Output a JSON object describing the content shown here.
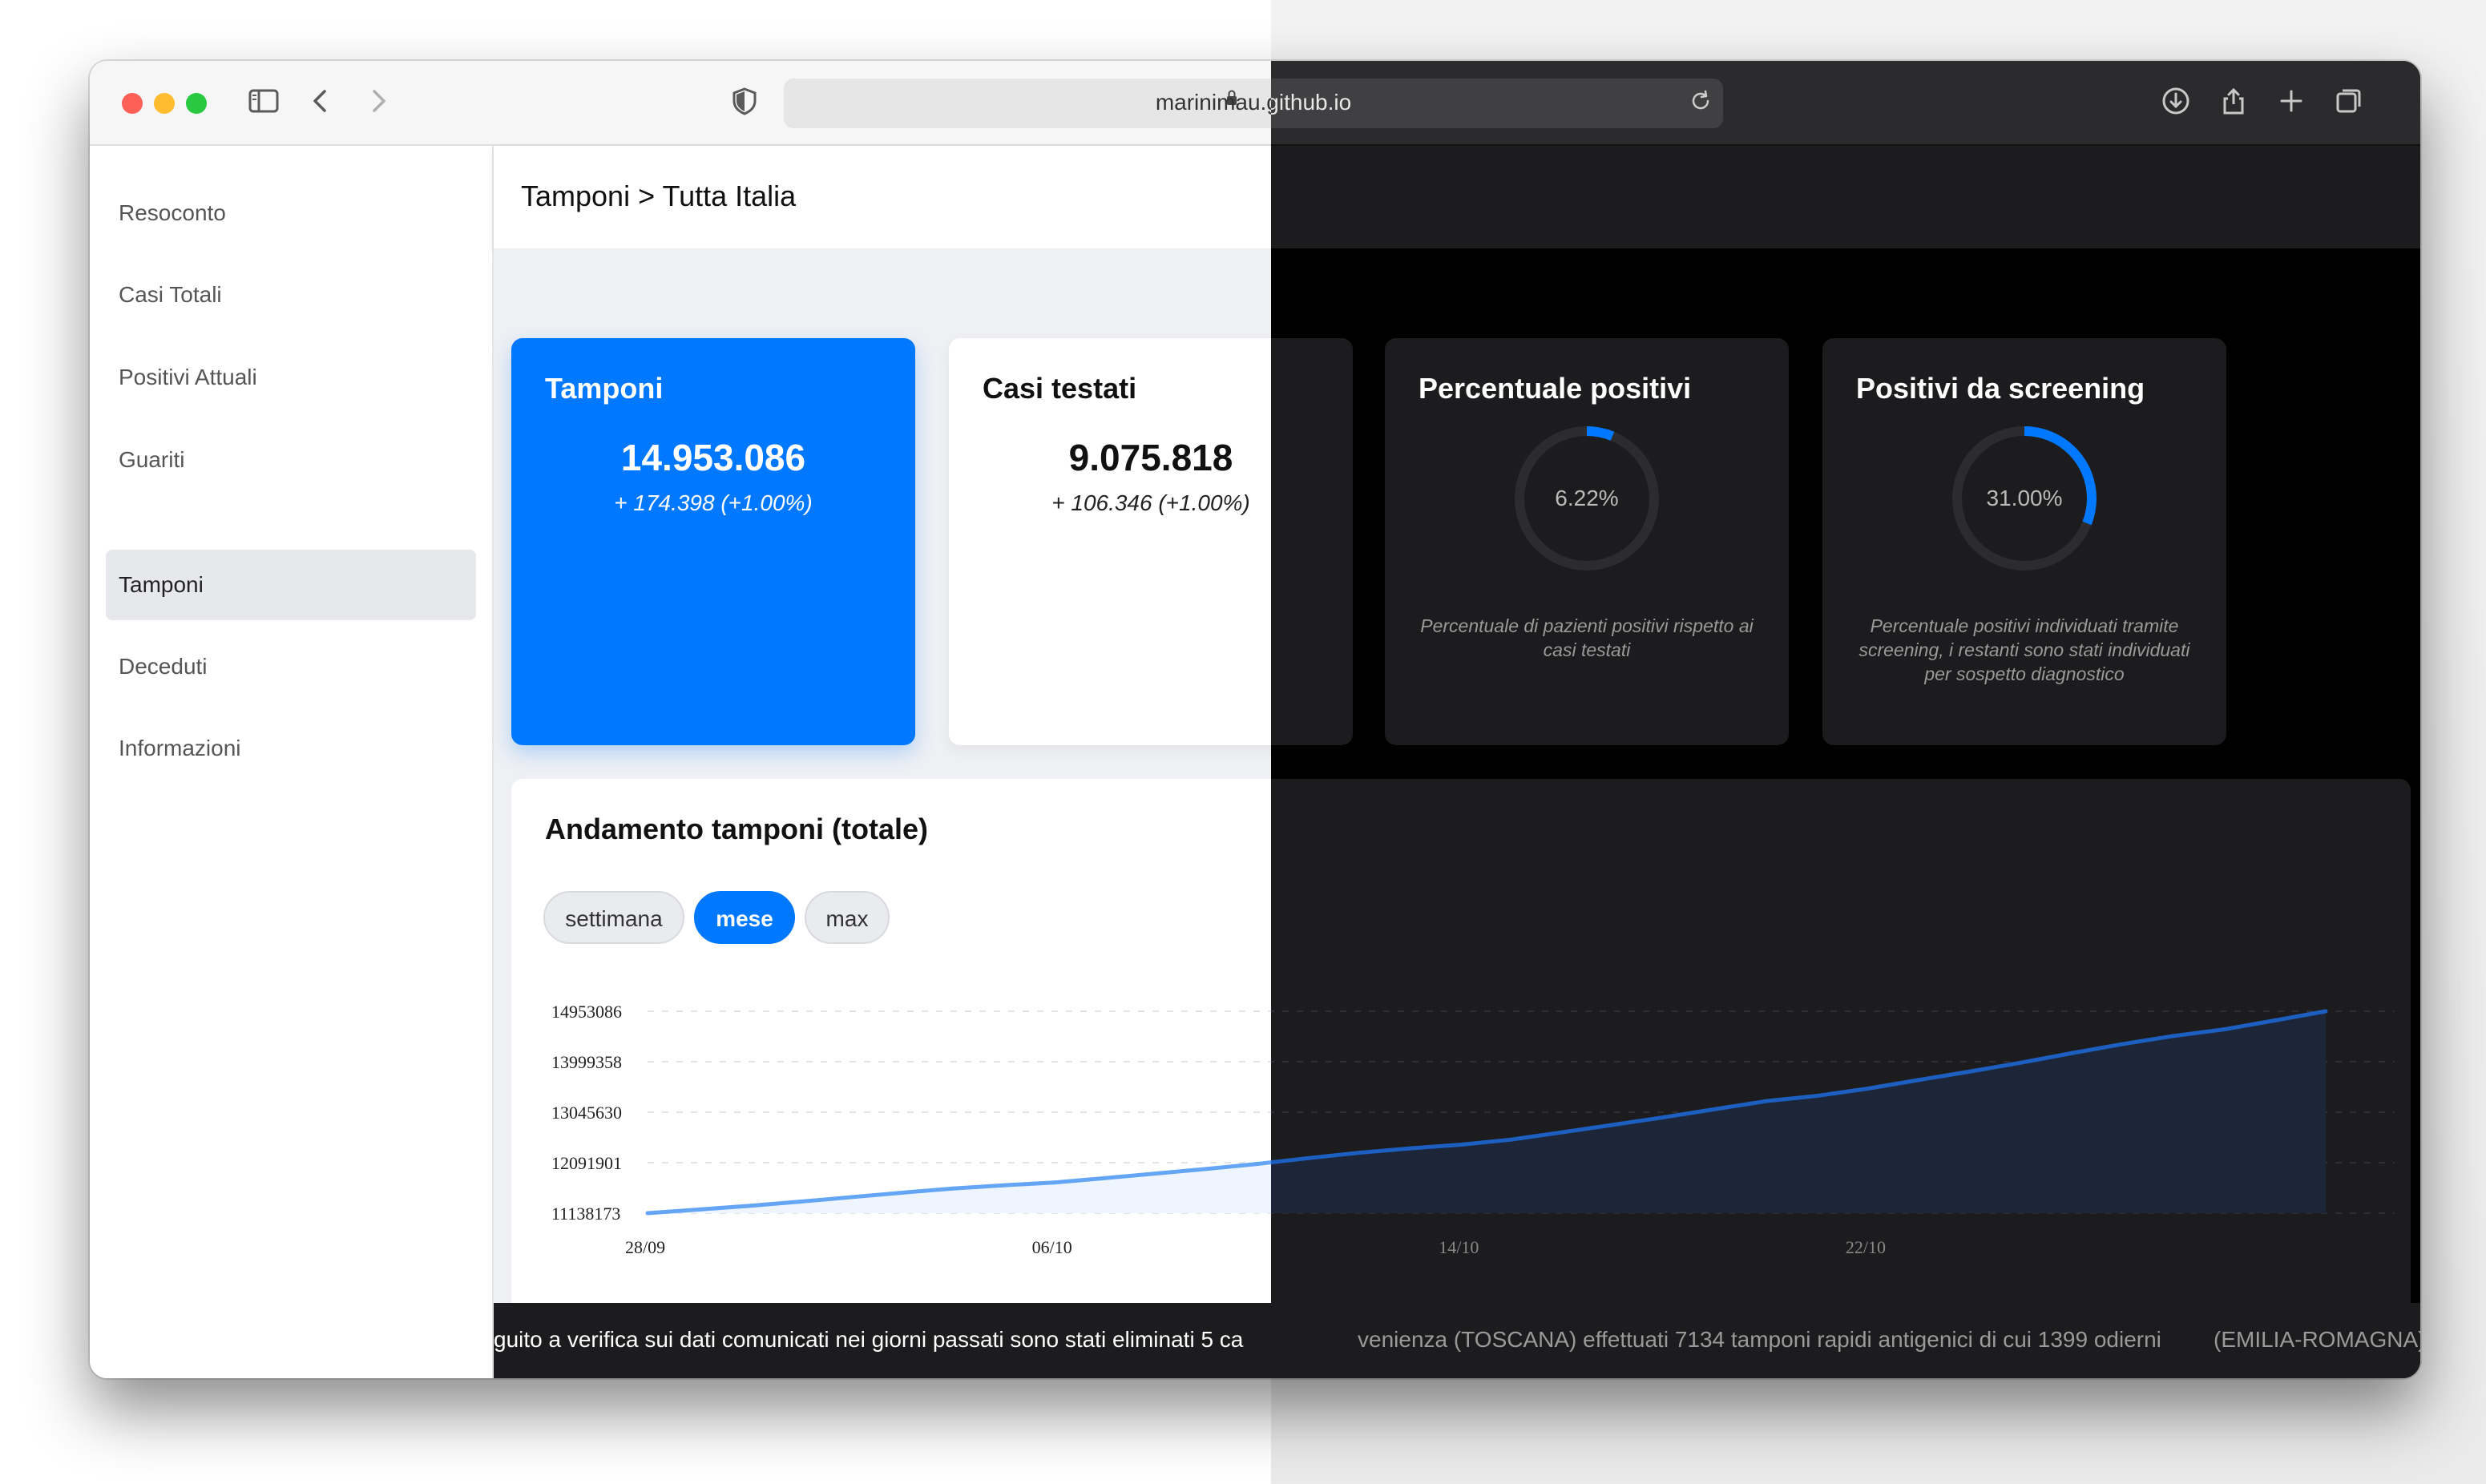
{
  "browser": {
    "url": "marinimau.github.io",
    "icons": {
      "sidebar": "sidebar-icon",
      "back": "chevron-left-icon",
      "forward": "chevron-right-icon",
      "shield": "shield-icon",
      "lock": "lock-icon",
      "reload": "reload-icon",
      "download": "download-icon",
      "share": "share-icon",
      "new_tab": "plus-icon",
      "tabs": "tabs-overview-icon"
    }
  },
  "sidebar": {
    "items": [
      {
        "label": "Resoconto"
      },
      {
        "label": "Casi Totali"
      },
      {
        "label": "Positivi Attuali"
      },
      {
        "label": "Guariti"
      },
      {
        "label": "Tamponi",
        "active": true
      },
      {
        "label": "Deceduti"
      },
      {
        "label": "Informazioni"
      }
    ]
  },
  "header": {
    "title": "Tamponi > Tutta Italia"
  },
  "cards": {
    "tamponi": {
      "title": "Tamponi",
      "value": "14.953.086",
      "delta": "+ 174.398 (+1.00%)"
    },
    "casi_testati": {
      "title": "Casi testati",
      "value": "9.075.818",
      "delta": "+ 106.346 (+1.00%)"
    },
    "percentuale_positivi": {
      "title": "Percentuale positivi",
      "gauge_label": "6.22%",
      "gauge_fraction": 0.0622,
      "description": "Percentuale di pazienti positivi rispetto ai casi testati"
    },
    "positivi_screening": {
      "title": "Positivi da screening",
      "gauge_label": "31.00%",
      "gauge_fraction": 0.31,
      "description": "Percentuale positivi individuati tramite screening, i restanti sono stati individuati per sospetto diagnostico"
    }
  },
  "chart": {
    "title": "Andamento tamponi (totale)",
    "ranges": [
      "settimana",
      "mese",
      "max"
    ],
    "selected_range": "mese"
  },
  "chart_data": {
    "type": "area",
    "title": "Andamento tamponi (totale)",
    "x_ticks": [
      "28/09",
      "06/10",
      "14/10",
      "22/10"
    ],
    "y_ticks": [
      11138173,
      12091901,
      13045630,
      13999358,
      14953086
    ],
    "ylim": [
      11138173,
      14953086
    ],
    "grid": true,
    "legend": "none",
    "series": [
      {
        "values": [
          11138173,
          11207000,
          11276000,
          11355000,
          11440000,
          11525000,
          11603000,
          11665000,
          11717000,
          11800000,
          11888000,
          11974000,
          12069000,
          12178000,
          12280000,
          12363000,
          12432000,
          12530000,
          12668000,
          12809000,
          12952000,
          13104000,
          13255000,
          13355000,
          13492000,
          13655000,
          13814000,
          13980000,
          14160000,
          14332000,
          14485000,
          14610000,
          14779000,
          14953086
        ]
      }
    ],
    "colors": {
      "line_light": "#64a6f5",
      "fill_light": "#eef5ff",
      "line_dark": "#1d5fc1",
      "fill_dark": "#1c2638"
    }
  },
  "ticker": {
    "text_left": "guito a verifica sui dati comunicati nei giorni passati sono stati eliminati 5 ca",
    "text_right": "venienza (TOSCANA) effettuati 7134 tamponi rapidi antigenici di cui 1399 odierni",
    "text_right_2": "(EMILIA-ROMAGNA)"
  },
  "colors": {
    "accent": "#0078ff",
    "gauge_track_light": "#e9e9ee",
    "gauge_track_dark": "#2c2c2e"
  }
}
